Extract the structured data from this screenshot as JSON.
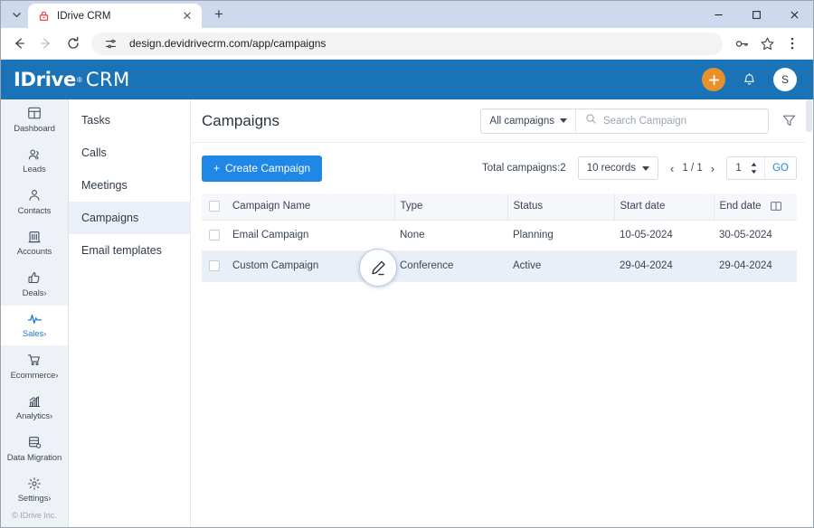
{
  "browser": {
    "tab": {
      "title": "IDrive CRM",
      "favicon": "lock-favicon",
      "close_label": "✕"
    },
    "new_tab_label": "+",
    "tab_list_label": "⌄",
    "window_controls": {
      "minimize": "–",
      "maximize": "□",
      "close": "✕"
    },
    "nav": {
      "back": "←",
      "forward": "→",
      "reload": "⟳"
    },
    "url": "design.devidrivecrm.com/app/campaigns",
    "site_settings_icon": "tune-icon",
    "password_icon": "key-icon",
    "bookmark_icon": "star-icon",
    "menu_icon": "kebab-menu-icon"
  },
  "app_header": {
    "logo_primary": "IDrive",
    "logo_reg": "®",
    "logo_secondary": "CRM",
    "add_button_label": "+",
    "notifications_icon": "bell-icon",
    "avatar_initial": "S",
    "background": "#1a73b7",
    "add_button_color": "#e8912a"
  },
  "rail": {
    "items": [
      {
        "label": "Dashboard",
        "icon": "dashboard-icon",
        "active": false,
        "chevron": ""
      },
      {
        "label": "Leads",
        "icon": "leads-icon",
        "active": false,
        "chevron": ""
      },
      {
        "label": "Contacts",
        "icon": "contacts-icon",
        "active": false,
        "chevron": ""
      },
      {
        "label": "Accounts",
        "icon": "accounts-icon",
        "active": false,
        "chevron": ""
      },
      {
        "label": "Deals",
        "icon": "deals-icon",
        "active": false,
        "chevron": "›"
      },
      {
        "label": "Sales",
        "icon": "sales-icon",
        "active": true,
        "chevron": "›"
      },
      {
        "label": "Ecommerce",
        "icon": "ecommerce-icon",
        "active": false,
        "chevron": "›"
      },
      {
        "label": "Analytics",
        "icon": "analytics-icon",
        "active": false,
        "chevron": "›"
      },
      {
        "label": "Data Migration",
        "icon": "data-migration-icon",
        "active": false,
        "chevron": ""
      },
      {
        "label": "Settings",
        "icon": "settings-icon",
        "active": false,
        "chevron": "›"
      }
    ],
    "footer": "© IDrive Inc."
  },
  "subnav": {
    "items": [
      {
        "label": "Tasks",
        "active": false
      },
      {
        "label": "Calls",
        "active": false
      },
      {
        "label": "Meetings",
        "active": false
      },
      {
        "label": "Campaigns",
        "active": true
      },
      {
        "label": "Email templates",
        "active": false
      }
    ]
  },
  "main": {
    "title": "Campaigns",
    "scope_filter": "All campaigns",
    "search_placeholder": "Search Campaign",
    "search_value": "",
    "search_icon": "search-icon",
    "filter_icon": "funnel-icon",
    "create_button": "Create Campaign",
    "create_button_plus": "+",
    "total_label": "Total campaigns:",
    "total_value": "2",
    "records_select": "10 records",
    "prev_label": "‹",
    "page_indicator": "1 / 1",
    "next_label": "›",
    "goto_value": "1",
    "go_label": "GO",
    "columns_icon": "columns-toggle-icon",
    "cursor_icon": "edit-pencil-icon"
  },
  "table": {
    "headers": [
      "Campaign Name",
      "Type",
      "Status",
      "Start date",
      "End date"
    ],
    "rows": [
      {
        "name": "Email Campaign",
        "type": "None",
        "status": "Planning",
        "start_date": "10-05-2024",
        "end_date": "30-05-2024",
        "hover": false
      },
      {
        "name": "Custom Campaign",
        "type": "Conference",
        "status": "Active",
        "start_date": "29-04-2024",
        "end_date": "29-04-2024",
        "hover": true
      }
    ]
  }
}
